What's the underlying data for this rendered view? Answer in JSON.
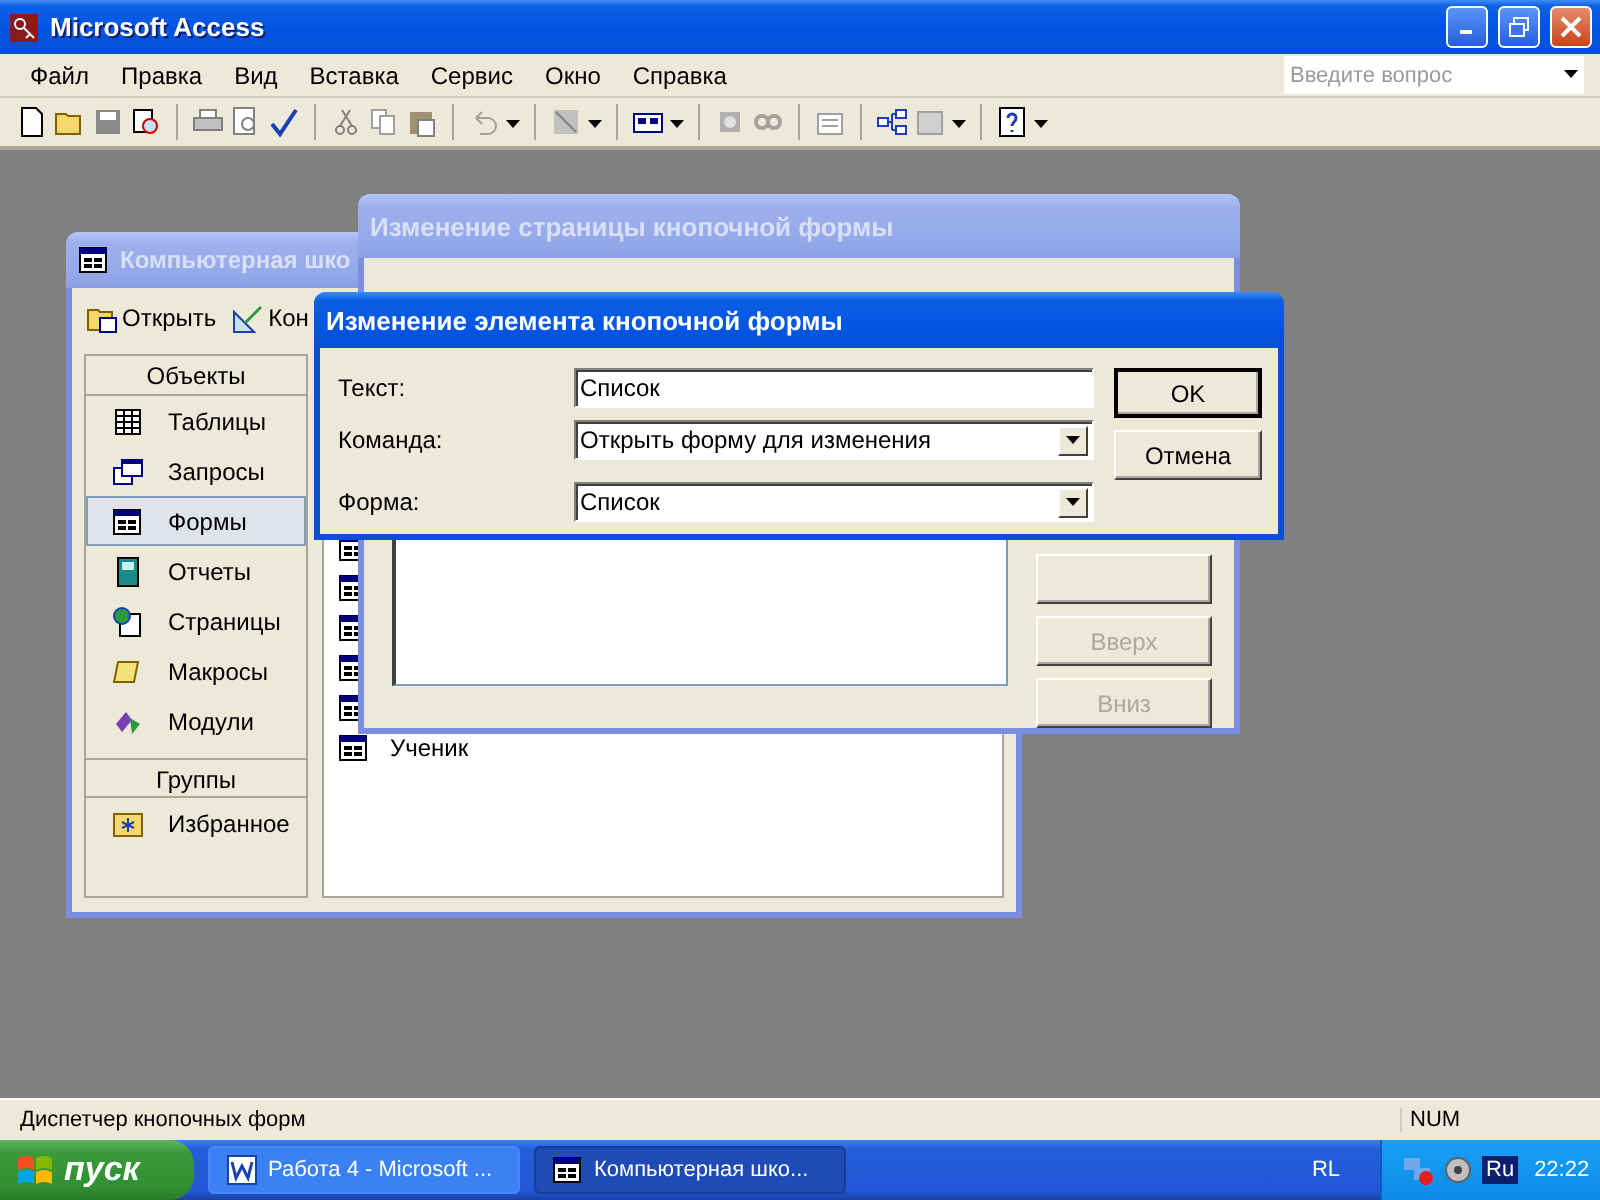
{
  "window": {
    "title": "Microsoft Access"
  },
  "menu": [
    "Файл",
    "Правка",
    "Вид",
    "Вставка",
    "Сервис",
    "Окно",
    "Справка"
  ],
  "help_search": {
    "placeholder": "Введите вопрос"
  },
  "database_window": {
    "title": "Компьютерная шко",
    "toolbar": [
      "Открыть",
      "Кон"
    ],
    "objects_header": "Объекты",
    "objects": [
      {
        "label": "Таблицы",
        "kind": "table",
        "selected": false
      },
      {
        "label": "Запросы",
        "kind": "query",
        "selected": false
      },
      {
        "label": "Формы",
        "kind": "form",
        "selected": true
      },
      {
        "label": "Отчеты",
        "kind": "report",
        "selected": false
      },
      {
        "label": "Страницы",
        "kind": "page",
        "selected": false
      },
      {
        "label": "Макросы",
        "kind": "macro",
        "selected": false
      },
      {
        "label": "Модули",
        "kind": "module",
        "selected": false
      }
    ],
    "groups_header": "Группы",
    "groups": [
      {
        "label": "Избранное"
      }
    ],
    "list": [
      {
        "kind": "covered"
      },
      {
        "kind": "covered"
      },
      {
        "kind": "covered"
      },
      {
        "kind": "covered"
      },
      {
        "kind": "covered"
      },
      {
        "kind": "named",
        "label": "Ученик"
      }
    ]
  },
  "page_dialog": {
    "title": "Изменение страницы кнопочной формы",
    "buttons": [
      {
        "kind": "covered"
      },
      {
        "kind": "named",
        "label": "Вверх",
        "disabled": true
      },
      {
        "kind": "named",
        "label": "Вниз",
        "disabled": true
      }
    ]
  },
  "item_dialog": {
    "title": "Изменение элемента кнопочной формы",
    "fields": [
      {
        "label": "Текст:",
        "value": "Список",
        "kind": "text"
      },
      {
        "label": "Команда:",
        "value": "Открыть форму для изменения",
        "kind": "dropdown"
      },
      {
        "label": "Форма:",
        "value": "Список",
        "kind": "dropdown"
      }
    ],
    "buttons": [
      "OK",
      "Отмена"
    ]
  },
  "status_bar": {
    "text": "Диспетчер кнопочных форм",
    "indicator": "NUM"
  },
  "taskbar": {
    "start": "пуск",
    "tasks": [
      {
        "label": "Работа 4 - Microsoft ...",
        "kind": "word",
        "selected": false
      },
      {
        "label": "Компьютерная шко...",
        "kind": "database",
        "selected": true
      }
    ],
    "language_bar": "RL",
    "tray_language": "Ru",
    "clock": "22:22"
  }
}
